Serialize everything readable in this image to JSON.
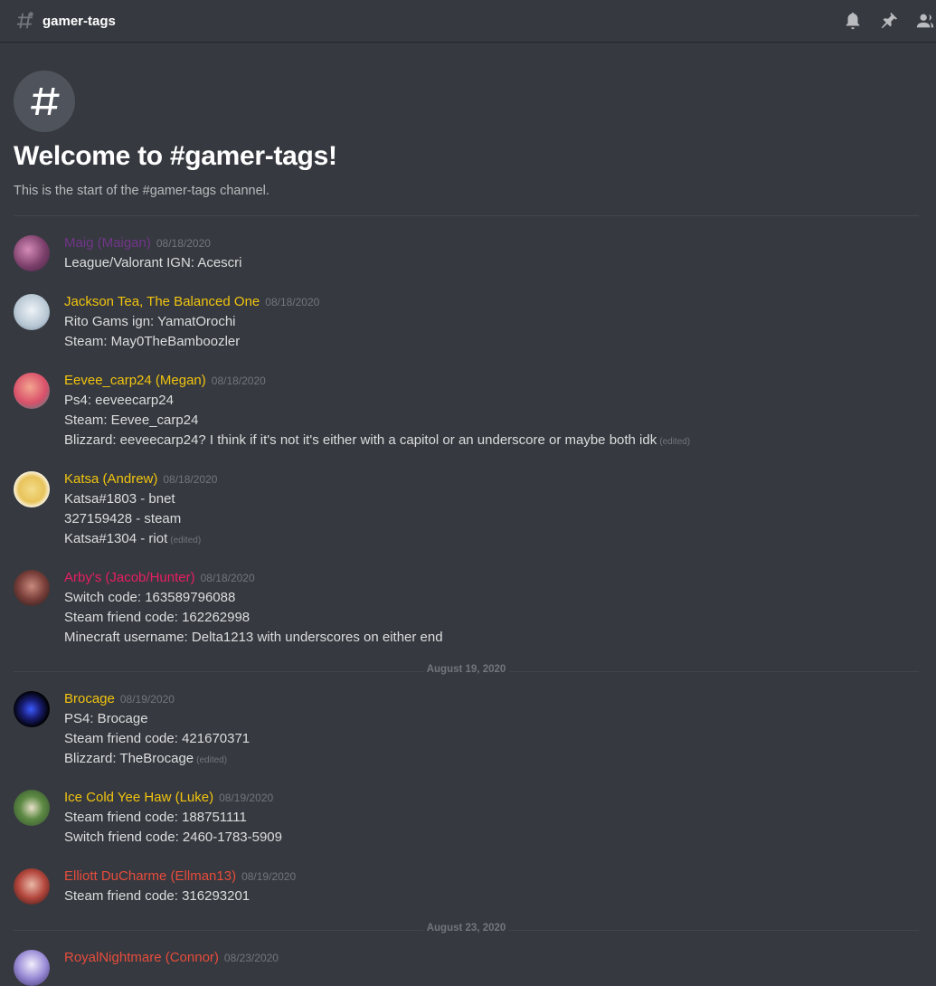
{
  "header": {
    "channel_name": "gamer-tags",
    "icons": [
      "hash-icon",
      "bell-icon",
      "pin-icon",
      "members-icon"
    ]
  },
  "welcome": {
    "title": "Welcome to #gamer-tags!",
    "subtitle": "This is the start of the #gamer-tags channel."
  },
  "colors": {
    "background": "#36393f",
    "purple_role": "#71368a",
    "gold_role": "#f1c40f",
    "pink_role": "#e91e63",
    "red_role": "#e74c3c"
  },
  "messages": [
    {
      "author": "Maig (Maigan)",
      "time": "08/18/2020",
      "lines": [
        "League/Valorant IGN: Acescri"
      ]
    },
    {
      "author": "Jackson Tea, The Balanced One",
      "time": "08/18/2020",
      "lines": [
        "Rito Gams ign: YamatOrochi",
        "Steam: May0TheBamboozler"
      ]
    },
    {
      "author": "Eevee_carp24 (Megan)",
      "time": "08/18/2020",
      "lines": [
        "Ps4: eeveecarp24",
        "Steam: Eevee_carp24",
        "Blizzard: eeveecarp24? I think if it's not it's either with a capitol or an underscore or maybe both idk"
      ],
      "edited": "(edited)"
    },
    {
      "author": "Katsa (Andrew)",
      "time": "08/18/2020",
      "lines": [
        "Katsa#1803 - bnet",
        "327159428 - steam",
        "Katsa#1304 - riot"
      ],
      "edited": "(edited)"
    },
    {
      "author": "Arby's (Jacob/Hunter)",
      "time": "08/18/2020",
      "lines": [
        "Switch code: 163589796088",
        "Steam friend code: 162262998",
        "Minecraft username: Delta1213 with underscores on either end"
      ]
    },
    {
      "author": "Brocage",
      "time": "08/19/2020",
      "lines": [
        "PS4: Brocage",
        "Steam friend code: 421670371",
        "Blizzard: TheBrocage"
      ],
      "edited": "(edited)"
    },
    {
      "author": "Ice Cold Yee Haw (Luke)",
      "time": "08/19/2020",
      "lines": [
        "Steam friend code: 188751111",
        "Switch friend code: 2460-1783-5909"
      ]
    },
    {
      "author": "Elliott DuCharme (Ellman13)",
      "time": "08/19/2020",
      "lines": [
        "Steam friend code: 316293201"
      ]
    },
    {
      "author": "RoyalNightmare (Connor)",
      "time": "08/23/2020",
      "lines": []
    }
  ],
  "date_dividers": [
    "August 19, 2020",
    "August 23, 2020"
  ]
}
